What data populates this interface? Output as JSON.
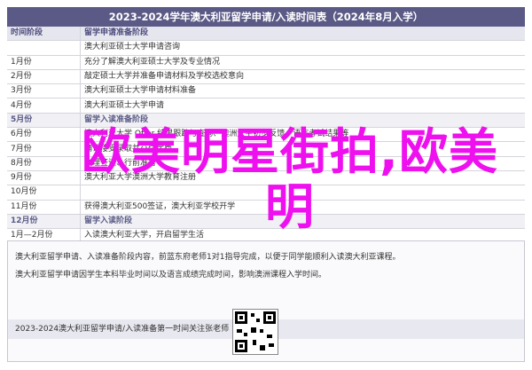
{
  "doc": {
    "title": "2023-2024学年澳大利亚留学申请/入读时间表（2024年8月入学）",
    "header": {
      "time": "时间阶段",
      "plan": "留学申请准备阶段"
    },
    "rows": [
      {
        "time": "",
        "text": "澳大利亚硕士大学申请咨询"
      },
      {
        "time": "1月份",
        "text": "充分了解澳大利亚硕士大学及专业情况"
      },
      {
        "time": "2月份",
        "text": "敲定硕士大学并准备申请材料及学校选校意向"
      },
      {
        "time": "3月份",
        "text": "澳大利亚硕士大学申请材料准备"
      },
      {
        "time": "4月份",
        "text": "澳大利亚硕士大学申请"
      },
      {
        "time": "5月份",
        "text": "",
        "stage": "留学入读准备阶段"
      },
      {
        "time": "6月份",
        "text": "澳大利亚大学 Offer 结果跟踪与查询、澳洲大学初步反馈、语言考试结果等"
      },
      {
        "time": "7月份",
        "text": "确认接受录取并交付学费"
      },
      {
        "time": "8月份",
        "text": "办理签证、行前准备"
      },
      {
        "time": "9月份",
        "text": "澳大利亚大学澳洲大学教育注册"
      },
      {
        "time": "10月份",
        "text": ""
      },
      {
        "time": "11月份",
        "text": "获得澳大利亚500签证，澳大利亚学校开学"
      },
      {
        "time": "12月份",
        "text": "",
        "stage": "留学入读阶段"
      },
      {
        "time": "1月—2月份",
        "text": "入读澳大利亚大学，开启留学生活"
      }
    ],
    "footer": {
      "line1": "澳大利亚留学申请、入读准备阶段内容，前蓝东府老师1对1指导完成，以便于同学能顺利入读澳大利亚课程。",
      "line2": "澳大利亚留学申请因学生本科毕业时间以及语言成绩完成时间，影响澳洲课程入学时间。",
      "bar": "2023-2024澳大利亚留学申请/入读准备第一时间关注张老师"
    },
    "watermark": "欧美明星街拍,欧美明"
  }
}
